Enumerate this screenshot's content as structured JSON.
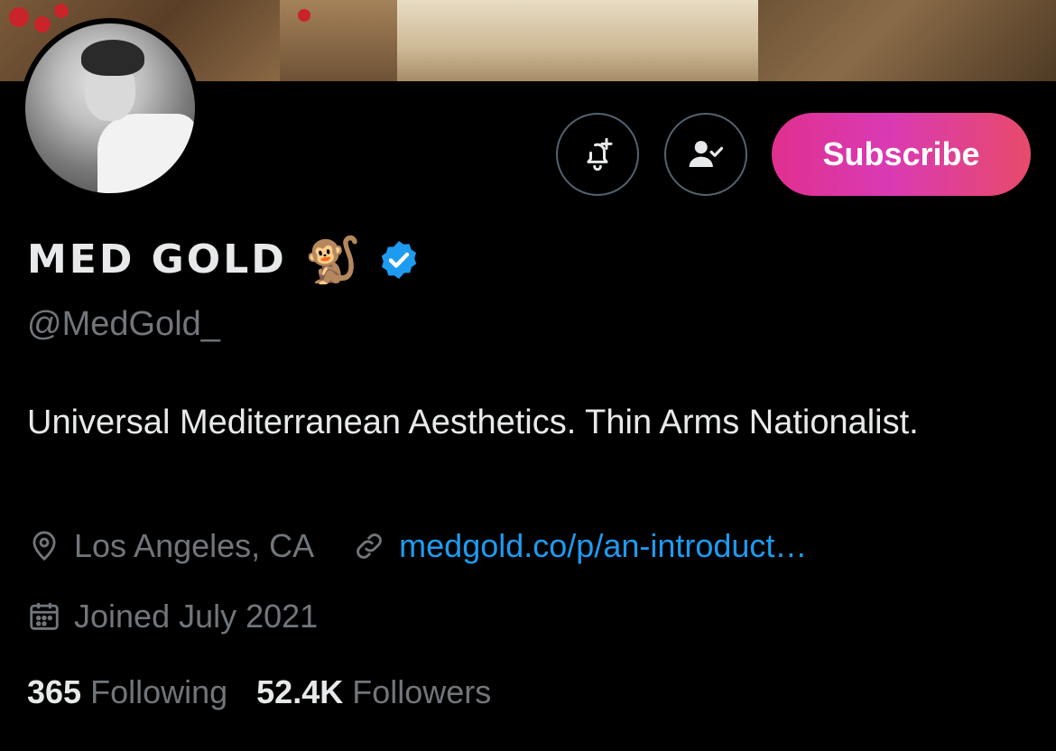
{
  "profile": {
    "display_name": "MED GOLD",
    "name_emoji": "🐒",
    "verified_icon": "verified-badge-icon",
    "handle": "@MedGold_",
    "bio": "Universal Mediterranean Aesthetics. Thin Arms Nationalist.",
    "location": "Los Angeles, CA",
    "website": "medgold.co/p/an-introduct…",
    "joined": "Joined July 2021"
  },
  "actions": {
    "notify_icon": "bell-plus-icon",
    "following_icon": "person-check-icon",
    "subscribe_label": "Subscribe"
  },
  "stats": {
    "following_count": "365",
    "following_label": "Following",
    "followers_count": "52.4K",
    "followers_label": "Followers"
  },
  "colors": {
    "background": "#000000",
    "accent_link": "#1d9bf0",
    "verified": "#1d9bf0",
    "subscribe_gradient_start": "#e0308f",
    "subscribe_gradient_end": "#e84a6a",
    "muted_text": "#71767b"
  }
}
